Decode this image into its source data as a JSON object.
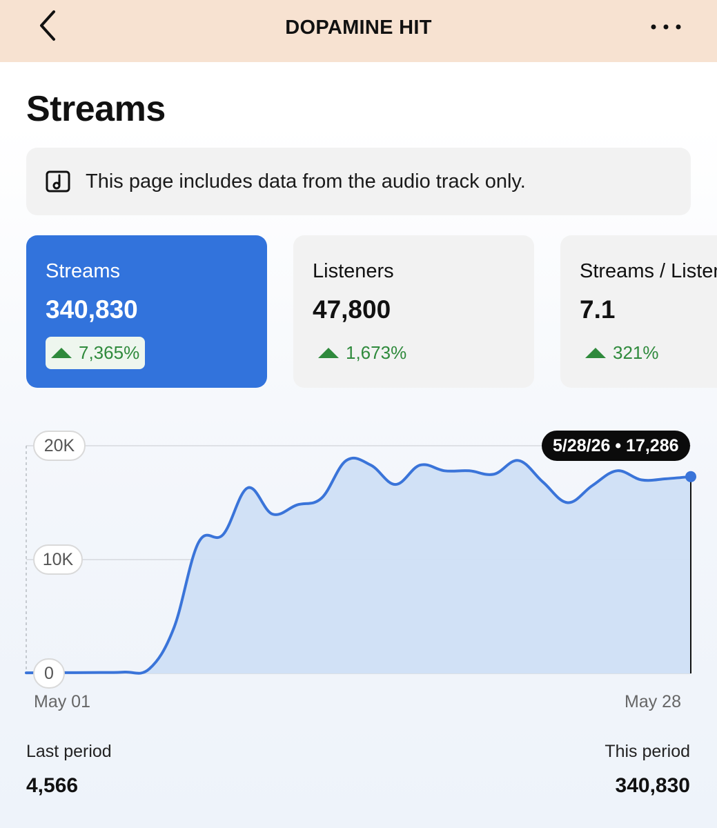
{
  "header": {
    "title": "DOPAMINE HIT",
    "back_icon": "chevron-left-icon",
    "more_icon": "more-horizontal-icon"
  },
  "page_title": "Streams",
  "info_banner": {
    "icon": "music-note-icon",
    "text": "This page includes data from the audio track only."
  },
  "metric_cards": [
    {
      "label": "Streams",
      "value": "340,830",
      "change": "7,365%",
      "selected": true
    },
    {
      "label": "Listeners",
      "value": "47,800",
      "change": "1,673%",
      "selected": false
    },
    {
      "label": "Streams / Listeners",
      "value": "7.1",
      "change": "321%",
      "selected": false
    }
  ],
  "colors": {
    "accent": "#3273dc",
    "positive": "#2f8a3c",
    "line": "#3a74d9",
    "fill": "#cfdff5",
    "header_bg": "#f7e2d1"
  },
  "chart_data": {
    "type": "area",
    "x": [
      "May 01",
      "May 02",
      "May 03",
      "May 04",
      "May 05",
      "May 06",
      "May 07",
      "May 08",
      "May 09",
      "May 10",
      "May 11",
      "May 12",
      "May 13",
      "May 14",
      "May 15",
      "May 16",
      "May 17",
      "May 18",
      "May 19",
      "May 20",
      "May 21",
      "May 22",
      "May 23",
      "May 24",
      "May 25",
      "May 26",
      "May 27",
      "May 28"
    ],
    "series": [
      {
        "values": [
          50,
          60,
          70,
          80,
          120,
          400,
          4000,
          11500,
          12200,
          16300,
          14000,
          14800,
          15400,
          18700,
          18300,
          16600,
          18300,
          17800,
          17800,
          17500,
          18700,
          16800,
          15000,
          16500,
          17800,
          17000,
          17100,
          17286
        ]
      }
    ],
    "x_tick_labels": [
      "May 01",
      "May 28"
    ],
    "y_tick_labels": [
      "0",
      "10K",
      "20K"
    ],
    "ylim": [
      0,
      20000
    ],
    "grid": true,
    "tooltip": {
      "label": "5/28/26 • 17,286",
      "x": "May 28",
      "y": 17286
    }
  },
  "comparison": {
    "last_period_label": "Last period",
    "last_period_value": "4,566",
    "this_period_label": "This period",
    "this_period_value": "340,830"
  }
}
